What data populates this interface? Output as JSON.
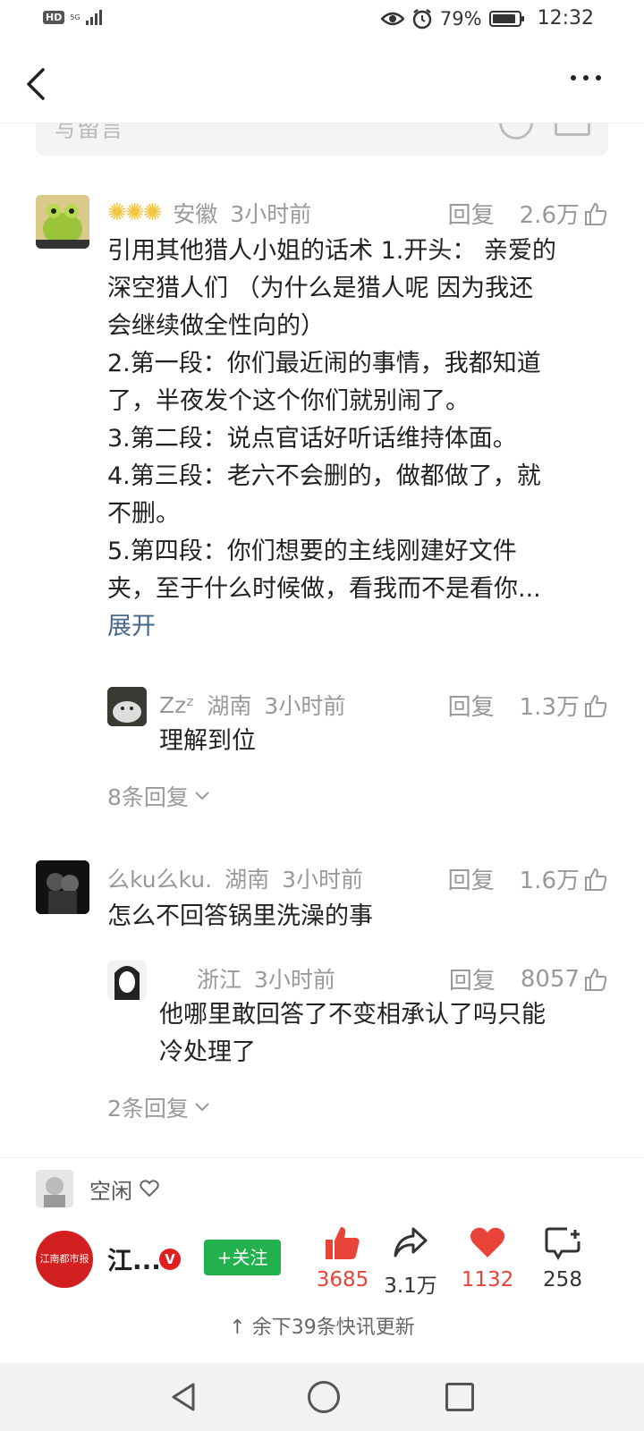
{
  "status_bar": {
    "hd": "HD",
    "network": "5G",
    "battery": "79%",
    "battery_level": 0.79,
    "time": "12:32"
  },
  "input_placeholder": "写留言",
  "comments": [
    {
      "user": "",
      "location": "安徽",
      "time": "3小时前",
      "reply_label": "回复",
      "likes": "2.6万",
      "lines": [
        "引用其他猎人小姐的话术 1.开头：  亲爱的",
        "深空猎人们  （为什么是猎人呢 因为我还",
        "会继续做全性向的）",
        "2.第一段：你们最近闹的事情，我都知道",
        "了，半夜发个这个你们就别闹了。",
        "3.第二段：说点官话好听话维持体面。",
        "4.第三段：老六不会删的，做都做了，就",
        "不删。",
        "5.第四段：你们想要的主线刚建好文件",
        "夹，至于什么时候做，看我而不是看你..."
      ],
      "expand": "展开",
      "reply": {
        "user": "Zzᶻ",
        "location": "湖南",
        "time": "3小时前",
        "reply_label": "回复",
        "likes": "1.3万",
        "text": "理解到位"
      },
      "more_replies": "8条回复"
    },
    {
      "user": "么ku么ku.",
      "location": "湖南",
      "time": "3小时前",
      "reply_label": "回复",
      "likes": "1.6万",
      "text": "怎么不回答锅里洗澡的事",
      "reply": {
        "user": "",
        "location": "浙江",
        "time": "3小时前",
        "reply_label": "回复",
        "likes": "8057",
        "lines": [
          "他哪里敢回答了不变相承认了吗只能",
          "冷处理了"
        ]
      },
      "more_replies": "2条回复"
    }
  ],
  "bottom": {
    "status_text": "空闲",
    "publisher_name": "江...",
    "verified": "V",
    "follow_label": "+关注",
    "publisher_logo_text": "江南都市报",
    "likes": "3685",
    "shares": "3.1万",
    "favorites": "1132",
    "comments": "258",
    "remaining": "↑ 余下39条快讯更新"
  },
  "colors": {
    "accent_red": "#e8443a",
    "follow_green": "#22b14c",
    "link_blue": "#44678e"
  }
}
